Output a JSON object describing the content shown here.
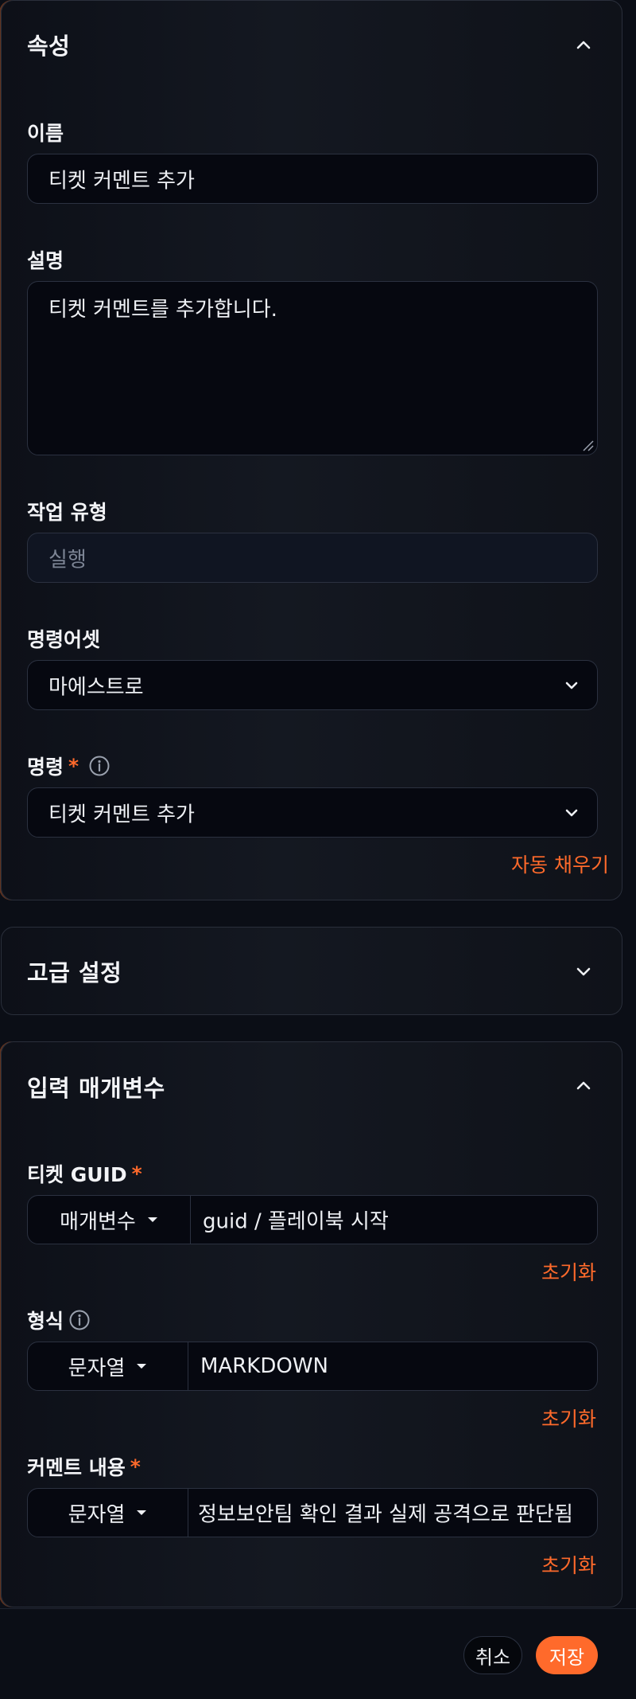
{
  "properties": {
    "title": "속성",
    "name_label": "이름",
    "name_value": "티켓 커멘트 추가",
    "desc_label": "설명",
    "desc_value": "티켓 커멘트를 추가합니다.",
    "job_type_label": "작업 유형",
    "job_type_value": "실행",
    "asset_label": "명령어셋",
    "asset_value": "마에스트로",
    "command_label": "명령",
    "command_required": "*",
    "command_value": "티켓 커멘트 추가",
    "autofill_label": "자동 채우기"
  },
  "advanced": {
    "title": "고급 설정"
  },
  "inputs": {
    "title": "입력 매개변수",
    "params": [
      {
        "label": "티켓 GUID",
        "required": "*",
        "type": "매개변수",
        "value": "guid / 플레이북 시작",
        "reset": "초기화"
      },
      {
        "label": "형식",
        "required": "",
        "type": "문자열",
        "value": "MARKDOWN",
        "reset": "초기화"
      },
      {
        "label": "커멘트 내용",
        "required": "*",
        "type": "문자열",
        "value": "정보보안팀 확인 결과 실제 공격으로 판단됨",
        "reset": "초기화"
      }
    ]
  },
  "footer": {
    "cancel_label": "취소",
    "save_label": "저장"
  },
  "colors": {
    "accent": "#ff6a2b",
    "background": "#0b0e16",
    "field": "#060810",
    "border": "#2b3140"
  }
}
